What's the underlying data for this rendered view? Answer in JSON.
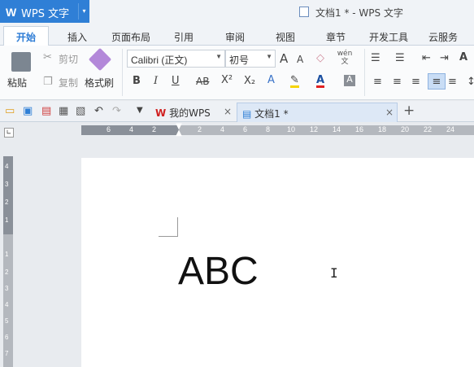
{
  "app": {
    "logo": "W",
    "name": "WPS 文字",
    "menu_arrow": "▾"
  },
  "window_title": "文档1 * - WPS 文字",
  "ribbon_tabs": [
    "开始",
    "插入",
    "页面布局",
    "引用",
    "审阅",
    "视图",
    "章节",
    "开发工具",
    "云服务"
  ],
  "clipboard": {
    "paste": "粘贴",
    "cut": "剪切",
    "copy": "复制",
    "format_painter": "格式刷"
  },
  "font": {
    "name": "Calibri (正文)",
    "size": "初号"
  },
  "format_buttons": {
    "bold": "B",
    "italic": "I",
    "underline": "U",
    "strike": "AB",
    "superscript": "X²",
    "subscript": "X₂",
    "grow": "A",
    "shrink": "A",
    "pinyin": "wén 文"
  },
  "doc_tabs": [
    {
      "label": "我的WPS",
      "close": "×"
    },
    {
      "label": "文档1 *",
      "close": "×"
    }
  ],
  "add_tab": "+",
  "ruler_numbers": [
    "6",
    "4",
    "2",
    "2",
    "4",
    "6",
    "8",
    "10",
    "12",
    "14",
    "16",
    "18",
    "20",
    "22",
    "24"
  ],
  "vruler_numbers": [
    "4",
    "3",
    "2",
    "1",
    "1",
    "2",
    "3",
    "4",
    "5",
    "6",
    "7"
  ],
  "document": {
    "text": "ABC"
  },
  "colors": {
    "accent": "#2f7fd6",
    "ruler": "#8a9099"
  }
}
